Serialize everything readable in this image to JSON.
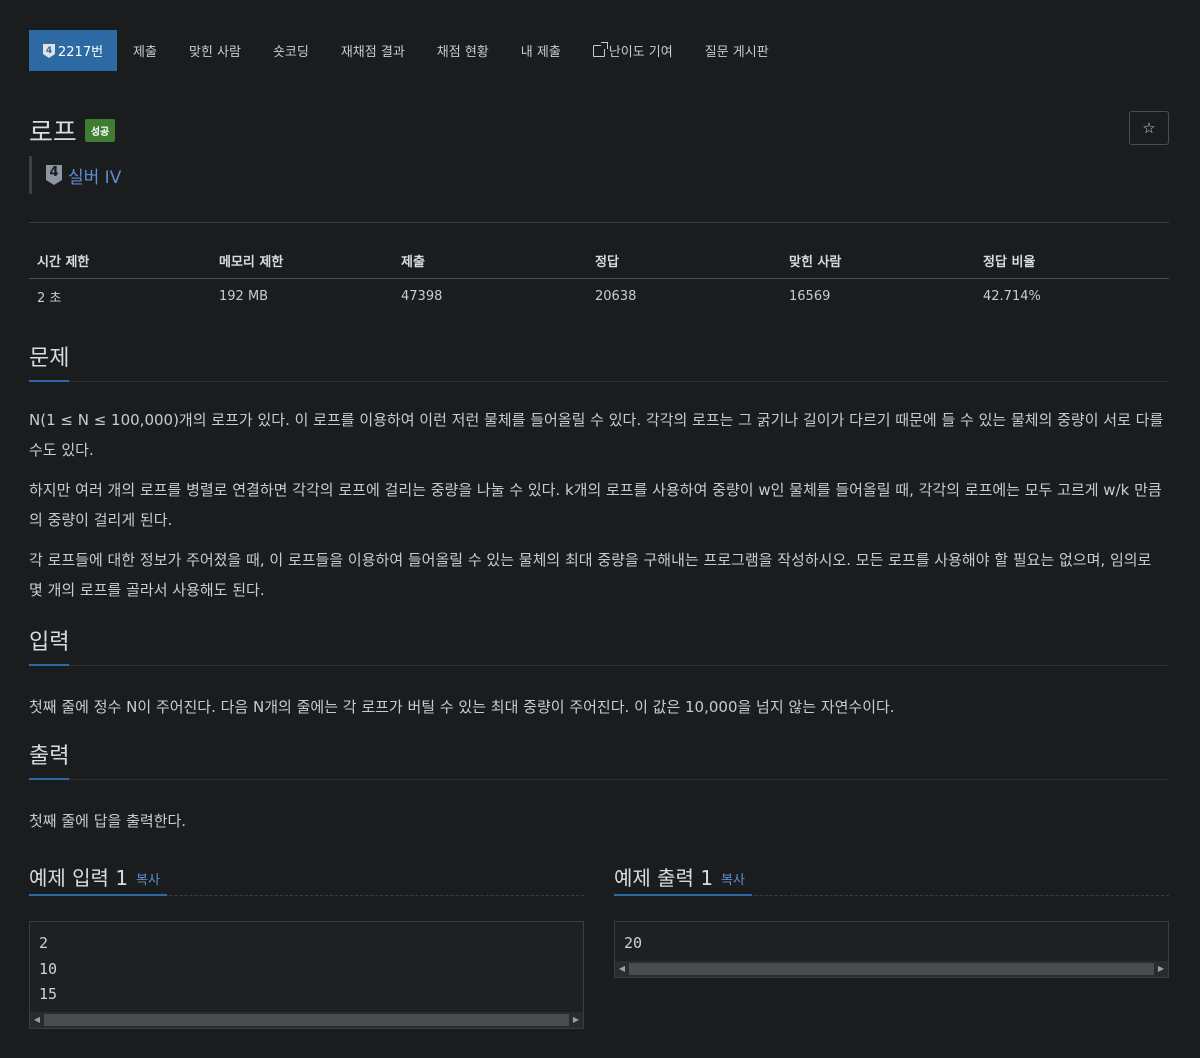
{
  "nav": {
    "items": [
      {
        "label": "2217번",
        "icon": "tier-badge-icon"
      },
      {
        "label": "제출"
      },
      {
        "label": "맞힌 사람"
      },
      {
        "label": "숏코딩"
      },
      {
        "label": "재채점 결과"
      },
      {
        "label": "채점 현황"
      },
      {
        "label": "내 제출"
      },
      {
        "label": "난이도 기여",
        "icon": "external-link-icon"
      },
      {
        "label": "질문 게시판"
      }
    ]
  },
  "problem": {
    "title": "로프",
    "status_badge": "성공",
    "tier_number": "4",
    "tier_label": "실버 IV",
    "star_icon": "☆"
  },
  "stats": {
    "headers": [
      "시간 제한",
      "메모리 제한",
      "제출",
      "정답",
      "맞힌 사람",
      "정답 비율"
    ],
    "values": [
      "2 초",
      "192 MB",
      "47398",
      "20638",
      "16569",
      "42.714%"
    ]
  },
  "sections": {
    "problem": {
      "heading": "문제",
      "paragraphs": [
        "N(1 ≤ N ≤ 100,000)개의 로프가 있다. 이 로프를 이용하여 이런 저런 물체를 들어올릴 수 있다. 각각의 로프는 그 굵기나 길이가 다르기 때문에 들 수 있는 물체의 중량이 서로 다를 수도 있다.",
        "하지만 여러 개의 로프를 병렬로 연결하면 각각의 로프에 걸리는 중량을 나눌 수 있다. k개의 로프를 사용하여 중량이 w인 물체를 들어올릴 때, 각각의 로프에는 모두 고르게 w/k 만큼의 중량이 걸리게 된다.",
        "각 로프들에 대한 정보가 주어졌을 때, 이 로프들을 이용하여 들어올릴 수 있는 물체의 최대 중량을 구해내는 프로그램을 작성하시오. 모든 로프를 사용해야 할 필요는 없으며, 임의로 몇 개의 로프를 골라서 사용해도 된다."
      ]
    },
    "input": {
      "heading": "입력",
      "text": "첫째 줄에 정수 N이 주어진다. 다음 N개의 줄에는 각 로프가 버틸 수 있는 최대 중량이 주어진다. 이 값은 10,000을 넘지 않는 자연수이다."
    },
    "output": {
      "heading": "출력",
      "text": "첫째 줄에 답을 출력한다."
    }
  },
  "examples": {
    "input": {
      "heading": "예제 입력 1",
      "copy_label": "복사",
      "lines": [
        "2",
        "10",
        "15"
      ]
    },
    "output": {
      "heading": "예제 출력 1",
      "copy_label": "복사",
      "lines": [
        "20"
      ]
    }
  },
  "colors": {
    "background": "#1b1c1e",
    "accent": "#2d6aa3",
    "success_badge": "#3e7d32",
    "link": "#5b8fcf"
  }
}
